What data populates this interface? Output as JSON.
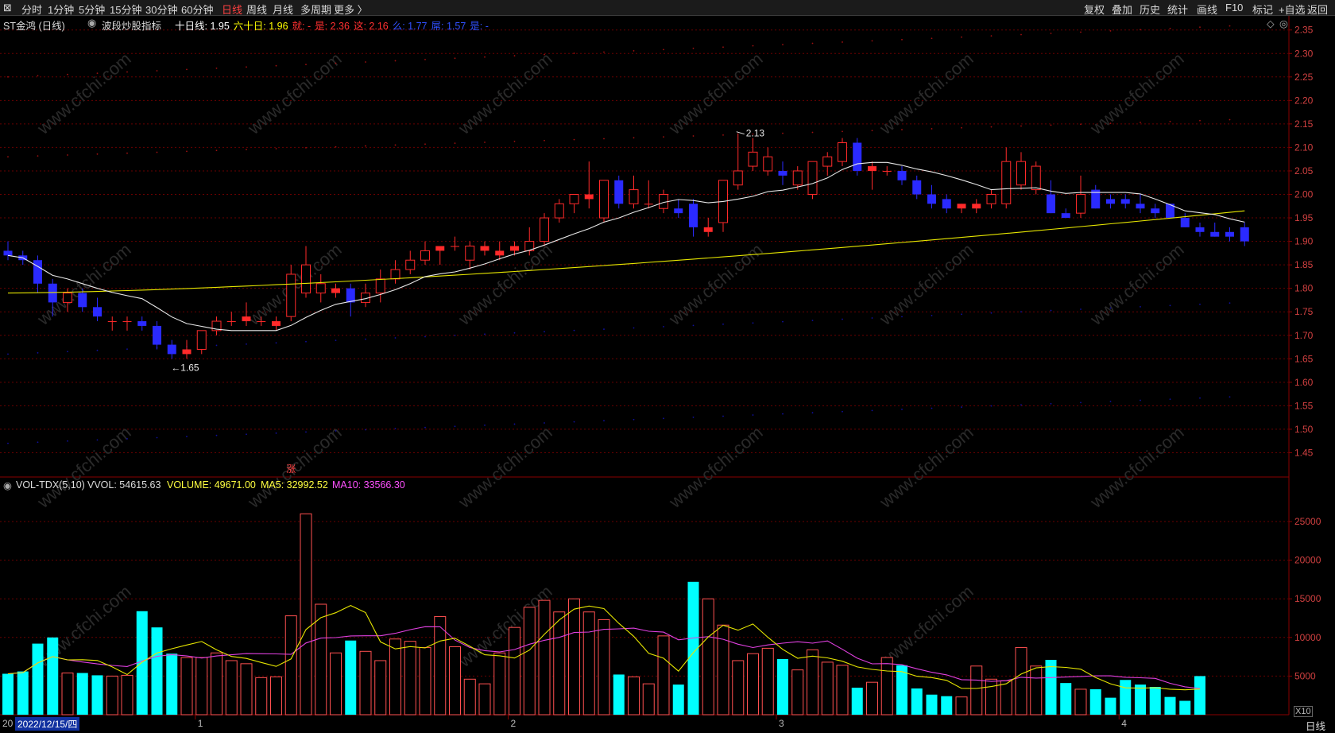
{
  "toolbar": {
    "left_icon": "⊠",
    "periods": [
      "分时",
      "1分钟",
      "5分钟",
      "15分钟",
      "30分钟",
      "60分钟",
      "日线",
      "周线",
      "月线",
      "多周期",
      "更多 〉"
    ],
    "active_period": "日线",
    "right": [
      "复权",
      "叠加",
      "历史",
      "统计",
      "画线",
      "F10",
      "标记",
      "+自选",
      "返回"
    ]
  },
  "header": {
    "stock": "ST金鸿 (日线)",
    "indicator": "波段炒股指标",
    "ma_items": [
      {
        "label": "十日线: 1.95",
        "color": "#ffffff"
      },
      {
        "label": "六十日: 1.96",
        "color": "#ffff00"
      },
      {
        "label": "就: -",
        "color": "#ff3030"
      },
      {
        "label": "是: 2.36",
        "color": "#ff3030"
      },
      {
        "label": "这: 2.16",
        "color": "#ff3030"
      },
      {
        "label": "么: 1.77",
        "color": "#3050ff"
      },
      {
        "label": "屌: 1.57",
        "color": "#3050ff"
      },
      {
        "label": "是: -",
        "color": "#3050ff"
      }
    ]
  },
  "vol_header": {
    "name": "VOL-TDX(5,10)",
    "vvol": "VVOL: 54615.63",
    "volume": "VOLUME: 49671.00",
    "ma5": "MA5: 32992.52",
    "ma10": "MA10: 33566.30"
  },
  "annotations": {
    "high": "2.13",
    "low": "←1.65",
    "zhang": "涨"
  },
  "axis": {
    "price_ticks": [
      "2.35",
      "2.30",
      "2.25",
      "2.20",
      "2.15",
      "2.10",
      "2.05",
      "2.00",
      "1.95",
      "1.90",
      "1.85",
      "1.80",
      "1.75",
      "1.70",
      "1.65",
      "1.60",
      "1.55",
      "1.50",
      "1.45"
    ],
    "vol_ticks": [
      "25000",
      "20000",
      "15000",
      "10000",
      "5000"
    ],
    "vol_unit": "X10",
    "period_label": "日线",
    "date_label": "2022/12/15/四",
    "date_prefix": "20",
    "month_labels": [
      "1",
      "2",
      "3",
      "4"
    ]
  },
  "watermark": "www.cfchi.com",
  "colors": {
    "up": "#ff2a2a",
    "down": "#2a2aff",
    "ma10": "#e8e8e8",
    "ma60": "#e6e600",
    "vol_up": "#ff5050",
    "vol_down": "#00ffff",
    "vma5": "#e6e600",
    "vma10": "#e040e0",
    "grid": "#6a0000"
  },
  "chart_data": {
    "type": "candlestick",
    "price_range": [
      1.4,
      2.38
    ],
    "volume_range": [
      0,
      28500
    ],
    "candles": [
      [
        1.88,
        1.9,
        1.86,
        1.87
      ],
      [
        1.87,
        1.88,
        1.85,
        1.86
      ],
      [
        1.86,
        1.87,
        1.79,
        1.81
      ],
      [
        1.81,
        1.82,
        1.74,
        1.77
      ],
      [
        1.77,
        1.8,
        1.75,
        1.79
      ],
      [
        1.79,
        1.8,
        1.75,
        1.76
      ],
      [
        1.76,
        1.78,
        1.73,
        1.74
      ],
      [
        1.73,
        1.74,
        1.71,
        1.73
      ],
      [
        1.73,
        1.74,
        1.71,
        1.73
      ],
      [
        1.73,
        1.74,
        1.71,
        1.72
      ],
      [
        1.72,
        1.73,
        1.67,
        1.68
      ],
      [
        1.68,
        1.69,
        1.65,
        1.66
      ],
      [
        1.66,
        1.69,
        1.65,
        1.67
      ],
      [
        1.67,
        1.71,
        1.66,
        1.71
      ],
      [
        1.71,
        1.74,
        1.7,
        1.73
      ],
      [
        1.73,
        1.75,
        1.72,
        1.73
      ],
      [
        1.73,
        1.77,
        1.72,
        1.74
      ],
      [
        1.73,
        1.74,
        1.72,
        1.73
      ],
      [
        1.72,
        1.74,
        1.71,
        1.73
      ],
      [
        1.74,
        1.85,
        1.73,
        1.83
      ],
      [
        1.79,
        1.89,
        1.78,
        1.85
      ],
      [
        1.79,
        1.83,
        1.77,
        1.81
      ],
      [
        1.79,
        1.81,
        1.78,
        1.8
      ],
      [
        1.8,
        1.81,
        1.74,
        1.77
      ],
      [
        1.77,
        1.81,
        1.76,
        1.79
      ],
      [
        1.79,
        1.84,
        1.77,
        1.82
      ],
      [
        1.82,
        1.86,
        1.81,
        1.84
      ],
      [
        1.84,
        1.88,
        1.83,
        1.86
      ],
      [
        1.86,
        1.9,
        1.85,
        1.88
      ],
      [
        1.88,
        1.89,
        1.85,
        1.89
      ],
      [
        1.89,
        1.91,
        1.88,
        1.89
      ],
      [
        1.86,
        1.9,
        1.84,
        1.89
      ],
      [
        1.88,
        1.9,
        1.87,
        1.89
      ],
      [
        1.87,
        1.9,
        1.86,
        1.88
      ],
      [
        1.88,
        1.9,
        1.87,
        1.89
      ],
      [
        1.88,
        1.93,
        1.87,
        1.9
      ],
      [
        1.9,
        1.96,
        1.89,
        1.95
      ],
      [
        1.95,
        1.99,
        1.94,
        1.98
      ],
      [
        1.98,
        2.0,
        1.96,
        2.0
      ],
      [
        1.99,
        2.07,
        1.97,
        2.0
      ],
      [
        1.95,
        2.03,
        1.94,
        2.03
      ],
      [
        2.03,
        2.04,
        1.97,
        1.98
      ],
      [
        1.98,
        2.04,
        1.97,
        2.01
      ],
      [
        1.98,
        2.03,
        1.97,
        1.98
      ],
      [
        1.97,
        2.01,
        1.96,
        2.0
      ],
      [
        1.97,
        1.99,
        1.95,
        1.96
      ],
      [
        1.98,
        1.99,
        1.91,
        1.93
      ],
      [
        1.92,
        1.95,
        1.91,
        1.93
      ],
      [
        1.94,
        2.01,
        1.92,
        2.03
      ],
      [
        2.02,
        2.13,
        2.01,
        2.05
      ],
      [
        2.06,
        2.12,
        2.05,
        2.09
      ],
      [
        2.05,
        2.1,
        2.04,
        2.08
      ],
      [
        2.05,
        2.07,
        2.02,
        2.04
      ],
      [
        2.02,
        2.06,
        2.01,
        2.05
      ],
      [
        2.0,
        2.05,
        1.99,
        2.07
      ],
      [
        2.06,
        2.09,
        2.04,
        2.08
      ],
      [
        2.07,
        2.12,
        2.06,
        2.11
      ],
      [
        2.11,
        2.12,
        2.04,
        2.05
      ],
      [
        2.05,
        2.07,
        2.01,
        2.06
      ],
      [
        2.05,
        2.06,
        2.04,
        2.05
      ],
      [
        2.05,
        2.06,
        2.02,
        2.03
      ],
      [
        2.03,
        2.04,
        1.99,
        2.0
      ],
      [
        2.0,
        2.02,
        1.97,
        1.98
      ],
      [
        1.99,
        2.0,
        1.96,
        1.97
      ],
      [
        1.97,
        1.98,
        1.96,
        1.98
      ],
      [
        1.97,
        1.99,
        1.96,
        1.98
      ],
      [
        1.98,
        2.01,
        1.97,
        2.0
      ],
      [
        1.98,
        2.1,
        1.97,
        2.07
      ],
      [
        2.02,
        2.09,
        2.01,
        2.07
      ],
      [
        2.01,
        2.07,
        2.0,
        2.06
      ],
      [
        2.0,
        2.03,
        1.96,
        1.96
      ],
      [
        1.96,
        1.97,
        1.95,
        1.95
      ],
      [
        1.96,
        2.04,
        1.95,
        2.0
      ],
      [
        2.01,
        2.02,
        1.97,
        1.97
      ],
      [
        1.99,
        2.0,
        1.97,
        1.98
      ],
      [
        1.99,
        2.0,
        1.97,
        1.98
      ],
      [
        1.98,
        2.0,
        1.96,
        1.97
      ],
      [
        1.97,
        1.98,
        1.95,
        1.96
      ],
      [
        1.98,
        1.98,
        1.95,
        1.95
      ],
      [
        1.95,
        1.96,
        1.93,
        1.93
      ],
      [
        1.93,
        1.94,
        1.91,
        1.92
      ],
      [
        1.92,
        1.94,
        1.91,
        1.91
      ],
      [
        1.92,
        1.93,
        1.9,
        1.91
      ],
      [
        1.93,
        1.94,
        1.89,
        1.9
      ]
    ],
    "volumes": [
      5300,
      5600,
      9200,
      10000,
      5400,
      5400,
      5100,
      5000,
      5100,
      13400,
      11300,
      7900,
      7400,
      7400,
      8000,
      7000,
      6600,
      4800,
      4900,
      12800,
      26000,
      14300,
      8000,
      9600,
      8200,
      7000,
      9800,
      9500,
      8700,
      12700,
      8800,
      4600,
      4000,
      8000,
      11300,
      13900,
      14800,
      13300,
      15000,
      13300,
      12300,
      5200,
      4900,
      4000,
      10200,
      3900,
      17200,
      15000,
      11600,
      7000,
      7900,
      8600,
      7200,
      5800,
      8400,
      6800,
      6400,
      3500,
      4200,
      7400,
      6400,
      3400,
      2600,
      2400,
      2300,
      6300,
      4600,
      4400,
      8700,
      6300,
      7100,
      4100,
      3300,
      3300,
      2200,
      4500,
      3900,
      3600,
      2300,
      1800,
      5000
    ],
    "x_labels": [
      "2022/12/15",
      "1",
      "2",
      "3",
      "4"
    ]
  }
}
